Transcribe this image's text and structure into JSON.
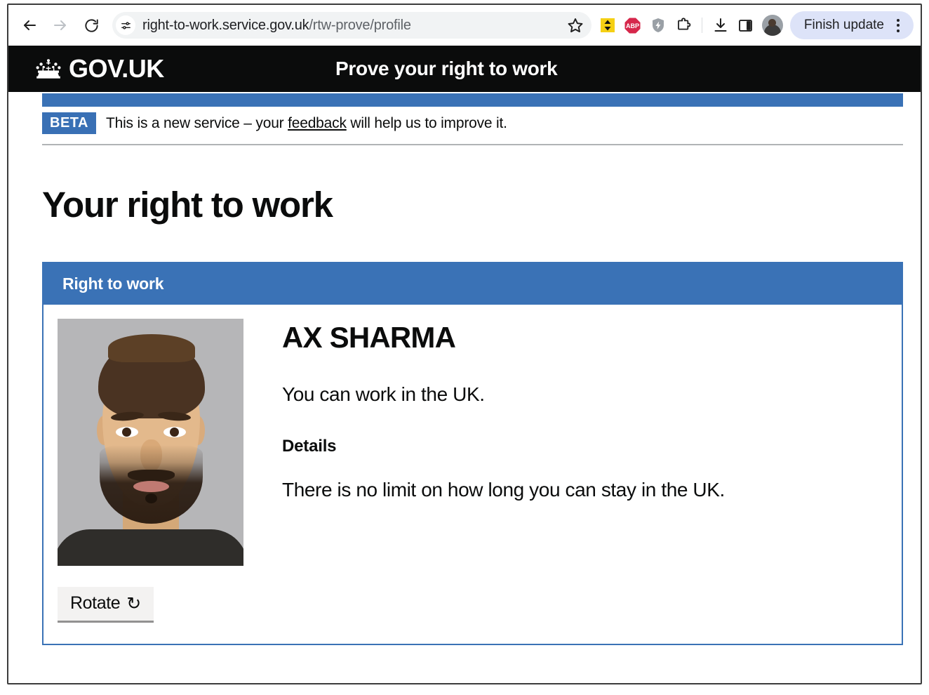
{
  "browser": {
    "back_label": "Back",
    "forward_label": "Forward",
    "reload_label": "Reload",
    "site_settings_label": "View site information",
    "url_bold": "right-to-work.service.gov.uk",
    "url_dim": "/rtw-prove/profile",
    "bookmark_label": "Bookmark this tab",
    "extensions": [
      {
        "name": "scroll-to-extension-icon",
        "label": "Scroll"
      },
      {
        "name": "adblock-plus-icon",
        "label": "ABP"
      },
      {
        "name": "shield-extension-icon",
        "label": "Shield"
      },
      {
        "name": "extensions-puzzle-icon",
        "label": "Extensions"
      },
      {
        "name": "downloads-icon",
        "label": "Downloads"
      },
      {
        "name": "side-panel-icon",
        "label": "Side panel"
      }
    ],
    "profile_label": "Profile",
    "finish_update_label": "Finish update",
    "menu_label": "Customise and control Chrome"
  },
  "govuk": {
    "brand": "GOV.UK",
    "crown_label": "crown-logo",
    "service_name": "Prove your right to work"
  },
  "phase_banner": {
    "tag": "BETA",
    "text_before": "This is a new service – your ",
    "link": "feedback",
    "text_after": " will help us to improve it."
  },
  "page": {
    "title": "Your right to work"
  },
  "card": {
    "header": "Right to work",
    "photo_alt": "passport-photo",
    "rotate_label": "Rotate",
    "rotate_icon": "↻",
    "person_name": "AX SHARMA",
    "status": "You can work in the UK.",
    "details_heading": "Details",
    "details_text": "There is no limit on how long you can stay in the UK."
  },
  "colors": {
    "govuk_black": "#0b0c0c",
    "govuk_blue": "#3a72b6",
    "beta_blue": "#3970b5",
    "button_grey": "#f3f2f1",
    "button_shadow": "#929191",
    "finish_update_bg": "#dde3f8"
  }
}
